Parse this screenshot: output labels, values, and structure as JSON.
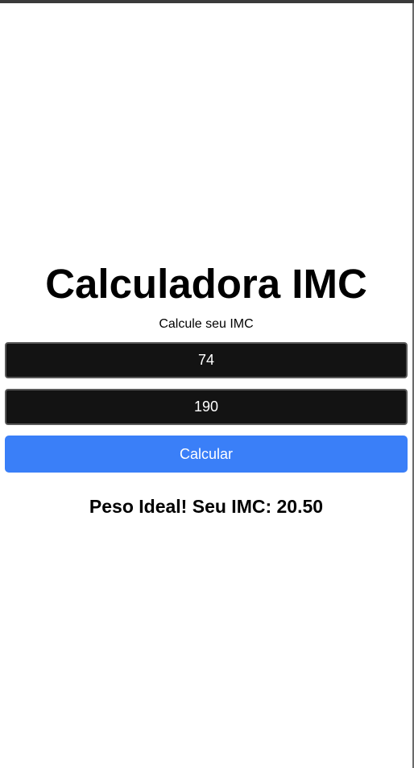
{
  "app": {
    "title": "Calculadora IMC",
    "subtitle": "Calcule seu IMC"
  },
  "form": {
    "weight_value": "74",
    "height_value": "190",
    "calculate_label": "Calcular"
  },
  "result": {
    "text": "Peso Ideal! Seu IMC: 20.50"
  },
  "colors": {
    "button_accent": "#3a7ff8",
    "input_background": "#131313",
    "page_background": "#ffffff"
  }
}
